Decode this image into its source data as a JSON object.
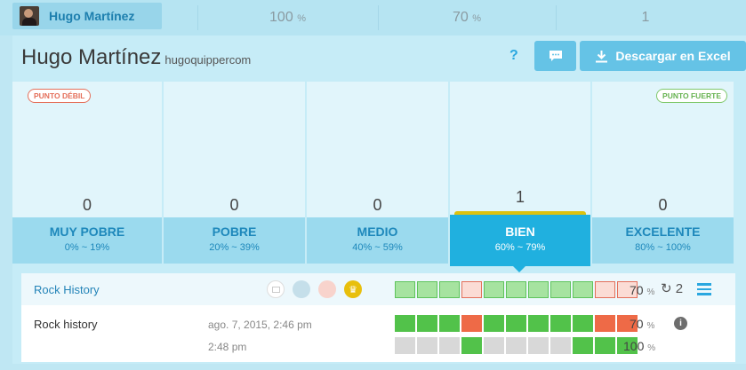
{
  "summary": {
    "user_name": "Hugo Martínez",
    "col1": "100",
    "col2": "70",
    "col3": "1",
    "pct_sign": "%"
  },
  "header": {
    "title": "Hugo Martínez",
    "handle": "hugoquippercom",
    "help": "?",
    "download_label": "Descargar en Excel"
  },
  "badges": {
    "weak": "PUNTO DÉBIL",
    "strong": "PUNTO FUERTE"
  },
  "levels": [
    {
      "count": "0",
      "label": "MUY POBRE",
      "range": "0% ~ 19%"
    },
    {
      "count": "0",
      "label": "POBRE",
      "range": "20% ~ 39%"
    },
    {
      "count": "0",
      "label": "MEDIO",
      "range": "40% ~ 59%"
    },
    {
      "count": "1",
      "label": "BIEN",
      "range": "60% ~ 79%"
    },
    {
      "count": "0",
      "label": "EXCELENTE",
      "range": "80% ~ 100%"
    }
  ],
  "active_level_index": 3,
  "quiz": {
    "title": "Rock History",
    "score": "70",
    "attempts": "2",
    "summary_segments": [
      "correct",
      "correct",
      "correct",
      "wrong",
      "correct",
      "correct",
      "correct",
      "correct",
      "correct",
      "wrong",
      "wrong"
    ],
    "attempt_name": "Rock history",
    "date_line1": "ago. 7, 2015, 2:46 pm",
    "date_line2": "2:48 pm",
    "attempt1_score": "70",
    "attempt1_segments": [
      "correct",
      "correct",
      "correct",
      "wrong",
      "correct",
      "correct",
      "correct",
      "correct",
      "correct",
      "wrong",
      "wrong"
    ],
    "attempt2_score": "100",
    "attempt2_segments": [
      "none",
      "none",
      "none",
      "correct",
      "none",
      "none",
      "none",
      "none",
      "correct",
      "correct",
      "correct"
    ]
  },
  "colors": {
    "light_correct": "#a6e3a0",
    "light_correct_border": "#5ec45c",
    "light_wrong": "#fbdcd5",
    "light_wrong_border": "#e46f5a",
    "solid_correct": "#52c24a",
    "solid_wrong": "#ee6a47",
    "solid_none": "#d8d8d8"
  },
  "icons": {
    "avatar": "avatar",
    "chat": "chat-icon",
    "download": "download-icon",
    "book": "book-icon",
    "crown": "crown-icon",
    "retry": "retry-icon",
    "menu": "menu-icon",
    "info": "info-icon"
  }
}
